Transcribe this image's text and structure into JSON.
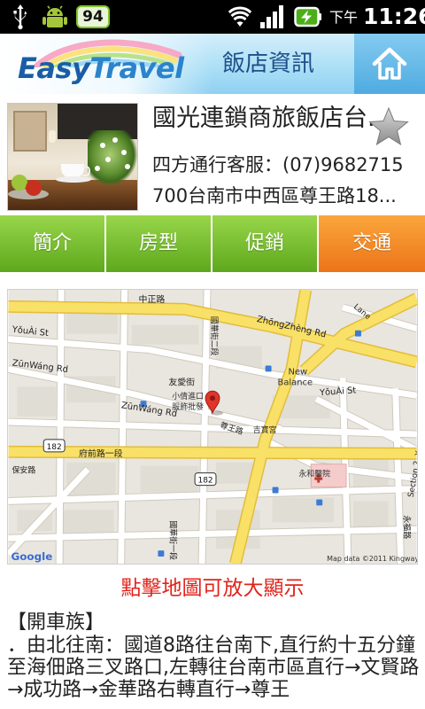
{
  "status_bar": {
    "battery_level": "94",
    "ampm": "下午",
    "time": "11:26",
    "icons": [
      "usb-icon",
      "android-icon",
      "wifi-icon",
      "signal-icon",
      "battery-charging-icon"
    ]
  },
  "app": {
    "logo_easy": "Easy",
    "logo_travel": "Travel",
    "title": "飯店資訊",
    "home_icon": "home-icon"
  },
  "hotel": {
    "name": "國光連鎖商旅飯店台...",
    "phone": "四方通行客服：(07)9682715",
    "address": "700台南市中西區尊王路18...",
    "favorite_icon": "star-icon"
  },
  "tabs": [
    {
      "label": "簡介",
      "active": false
    },
    {
      "label": "房型",
      "active": false
    },
    {
      "label": "促銷",
      "active": false
    },
    {
      "label": "交通",
      "active": true
    }
  ],
  "colors": {
    "tab_green": "#6cb524",
    "tab_active_orange": "#f08a1f",
    "hint_red": "#e0241b",
    "header_blue": "#8fd0f1",
    "map_main_road": "#f9e067"
  },
  "map": {
    "marker_icon": "map-marker-icon",
    "labels": [
      {
        "id": "zhongzheng-zh",
        "text": "中正路"
      },
      {
        "id": "zhongzheng-en",
        "text": "ZhōngZhèng Rd"
      },
      {
        "id": "youai-en-left",
        "text": "YǒuÀi St"
      },
      {
        "id": "youai-en-right",
        "text": "YǒuÀi St"
      },
      {
        "id": "zunwang-en-left",
        "text": "ZūnWáng Rd"
      },
      {
        "id": "zunwang-en-center",
        "text": "ZūnWáng Rd"
      },
      {
        "id": "youai-zh",
        "text": "友愛街"
      },
      {
        "id": "poi-shop-1",
        "text": "小倩進口"
      },
      {
        "id": "poi-shop-2",
        "text": "服飾批發"
      },
      {
        "id": "zunwang-zh",
        "text": "尊王路"
      },
      {
        "id": "poi-temple",
        "text": "吉寶宮"
      },
      {
        "id": "poi-newbalance-1",
        "text": "New"
      },
      {
        "id": "poi-newbalance-2",
        "text": "Balance"
      },
      {
        "id": "fuqian-zh",
        "text": "府前路一段"
      },
      {
        "id": "guohua-2",
        "text": "國華街二段"
      },
      {
        "id": "guohua-1",
        "text": "國華街一段"
      },
      {
        "id": "baoan-zh",
        "text": "保安路"
      },
      {
        "id": "poi-hospital",
        "text": "永和醫院"
      },
      {
        "id": "yongfu-zh",
        "text": "永福路"
      },
      {
        "id": "yongfu-en",
        "text": "Section 2, Yong"
      },
      {
        "id": "lane",
        "text": "Lane"
      },
      {
        "id": "route-182-a",
        "text": "182"
      },
      {
        "id": "route-182-b",
        "text": "182"
      },
      {
        "id": "attribution",
        "text": "Map data ©2011 Kingway"
      },
      {
        "id": "google-logo",
        "text": "Google"
      }
    ]
  },
  "map_hint": "點擊地圖可放大顯示",
  "directions": {
    "heading": "【開車族】",
    "text": "．由北往南：國道8路往台南下,直行約十五分鐘至海佃路三叉路口,左轉往台南市區直行→文賢路→成功路→金華路右轉直行→尊王"
  }
}
